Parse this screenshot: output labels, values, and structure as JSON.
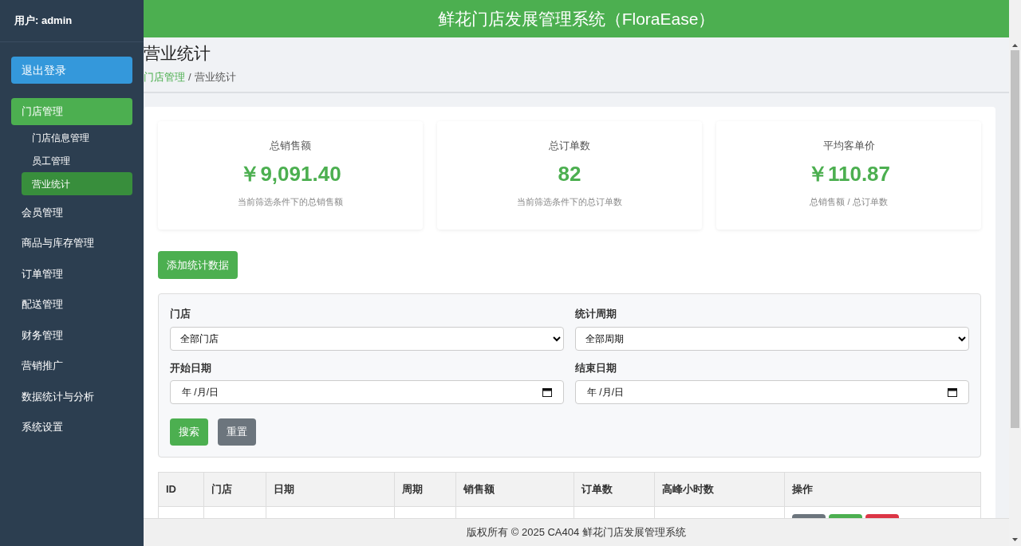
{
  "sidebar": {
    "user": "用户: admin",
    "logout": "退出登录",
    "items": [
      {
        "label": "门店管理",
        "selected": true,
        "children": [
          {
            "label": "门店信息管理",
            "selected": false
          },
          {
            "label": "员工管理",
            "selected": false
          },
          {
            "label": "营业统计",
            "selected": true
          }
        ]
      },
      {
        "label": "会员管理",
        "selected": false
      },
      {
        "label": "商品与库存管理",
        "selected": false
      },
      {
        "label": "订单管理",
        "selected": false
      },
      {
        "label": "配送管理",
        "selected": false
      },
      {
        "label": "财务管理",
        "selected": false
      },
      {
        "label": "营销推广",
        "selected": false
      },
      {
        "label": "数据统计与分析",
        "selected": false
      },
      {
        "label": "系统设置",
        "selected": false
      }
    ]
  },
  "header": {
    "title": "鲜花门店发展管理系统（FloraEase）"
  },
  "page": {
    "title": "营业统计",
    "breadcrumb": [
      {
        "label": "门店管理",
        "kind": "link"
      },
      {
        "label": "/",
        "kind": "separator"
      },
      {
        "label": "营业统计",
        "kind": "current"
      }
    ]
  },
  "cards": [
    {
      "label": "总销售额",
      "value": "￥9,091.40",
      "note": "当前筛选条件下的总销售额"
    },
    {
      "label": "总订单数",
      "value": "82",
      "note": "当前筛选条件下的总订单数"
    },
    {
      "label": "平均客单价",
      "value": "￥110.87",
      "note": "总销售额 / 总订单数"
    }
  ],
  "add_button": "添加统计数据",
  "filters": [
    {
      "label": "门店",
      "kind": "select",
      "value": "全部门店"
    },
    {
      "label": "统计周期",
      "kind": "select",
      "value": "全部周期"
    },
    {
      "label": "开始日期",
      "kind": "date",
      "value": "年 /月/日"
    },
    {
      "label": "结束日期",
      "kind": "date",
      "value": "年 /月/日"
    }
  ],
  "filter_buttons": {
    "search": "搜索",
    "reset": "重置"
  },
  "table": {
    "columns": [
      "ID",
      "门店",
      "日期",
      "周期",
      "销售额",
      "订单数",
      "高峰小时数",
      "操作"
    ]
  },
  "footer": "版权所有 © 2025 CA404 鲜花门店发展管理系统"
}
